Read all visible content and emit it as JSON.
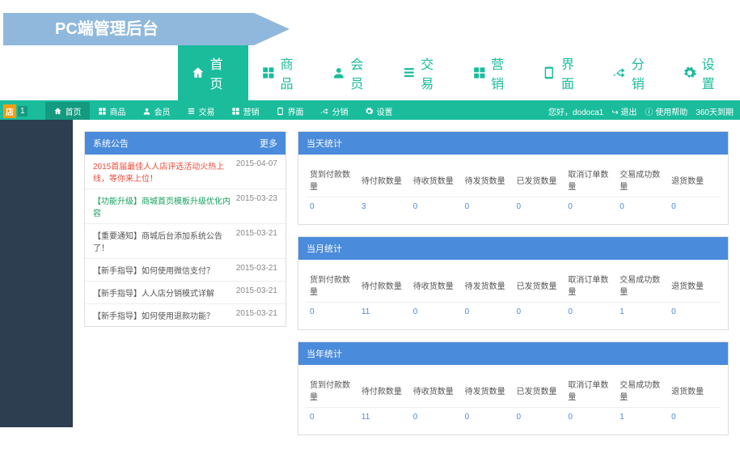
{
  "banner": {
    "title": "PC端管理后台"
  },
  "mainNav": [
    {
      "label": "首页",
      "icon": "home",
      "active": true
    },
    {
      "label": "商品",
      "icon": "grid",
      "active": false
    },
    {
      "label": "会员",
      "icon": "user",
      "active": false
    },
    {
      "label": "交易",
      "icon": "list",
      "active": false
    },
    {
      "label": "营销",
      "icon": "grid",
      "active": false
    },
    {
      "label": "界面",
      "icon": "device",
      "active": false
    },
    {
      "label": "分销",
      "icon": "shuffle",
      "active": false
    },
    {
      "label": "设置",
      "icon": "gear",
      "active": false
    }
  ],
  "tealNav": [
    {
      "label": "首页",
      "icon": "home",
      "active": true
    },
    {
      "label": "商品",
      "icon": "grid"
    },
    {
      "label": "会员",
      "icon": "user"
    },
    {
      "label": "交易",
      "icon": "list"
    },
    {
      "label": "营销",
      "icon": "grid"
    },
    {
      "label": "界面",
      "icon": "device"
    },
    {
      "label": "分销",
      "icon": "shuffle"
    },
    {
      "label": "设置",
      "icon": "gear"
    }
  ],
  "logo": {
    "text": "店"
  },
  "topRight": {
    "greeting": "您好，dodoca1",
    "logout": "退出",
    "help": "使用帮助",
    "expire": "360天到期"
  },
  "notices": {
    "title": "系统公告",
    "more": "更多",
    "items": [
      {
        "text": "2015首届最佳人人店评选活动火热上线，等你来上位！",
        "date": "2015-04-07",
        "cls": "red"
      },
      {
        "text": "【功能升级】商城首页模板升级优化内容",
        "date": "2015-03-23",
        "cls": "green"
      },
      {
        "text": "【重要通知】商城后台添加系统公告了！",
        "date": "2015-03-21",
        "cls": "gray"
      },
      {
        "text": "【新手指导】如何使用微信支付？",
        "date": "2015-03-21",
        "cls": "gray"
      },
      {
        "text": "【新手指导】人人店分销模式详解",
        "date": "2015-03-21",
        "cls": "gray"
      },
      {
        "text": "【新手指导】如何使用退款功能？",
        "date": "2015-03-21",
        "cls": "gray"
      }
    ]
  },
  "statHeaders": [
    "货到付款数量",
    "待付款数量",
    "待收货数量",
    "待发货数量",
    "已发货数量",
    "取消订单数量",
    "交易成功数量",
    "退货数量"
  ],
  "stats": [
    {
      "title": "当天统计",
      "values": [
        "0",
        "3",
        "0",
        "0",
        "0",
        "0",
        "0",
        "0"
      ]
    },
    {
      "title": "当月统计",
      "values": [
        "0",
        "11",
        "0",
        "0",
        "0",
        "0",
        "1",
        "0"
      ]
    },
    {
      "title": "当年统计",
      "values": [
        "0",
        "11",
        "0",
        "0",
        "0",
        "0",
        "1",
        "0"
      ]
    }
  ]
}
